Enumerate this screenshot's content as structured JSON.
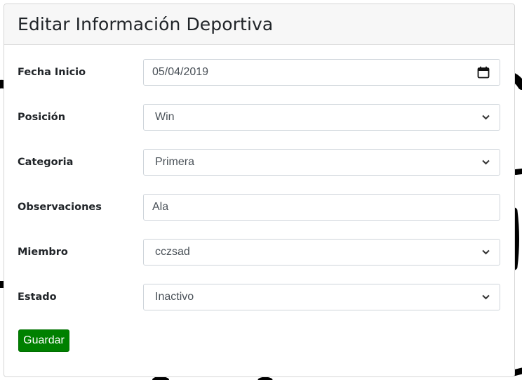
{
  "form": {
    "title": "Editar Información Deportiva",
    "fields": [
      {
        "label": "Fecha Inicio",
        "value": "05/04/2019",
        "type": "date",
        "icon": "calendar-icon"
      },
      {
        "label": "Posición",
        "value": "Win",
        "type": "select",
        "icon": "chevron-down-icon"
      },
      {
        "label": "Categoria",
        "value": "Primera",
        "type": "select",
        "icon": "chevron-down-icon"
      },
      {
        "label": "Observaciones",
        "value": "Ala",
        "type": "text"
      },
      {
        "label": "Miembro",
        "value": "cczsad",
        "type": "select",
        "icon": "chevron-down-icon"
      },
      {
        "label": "Estado",
        "value": "Inactivo",
        "type": "select",
        "icon": "chevron-down-icon"
      }
    ],
    "save_label": "Guardar"
  },
  "colors": {
    "save_button": "#008000",
    "header_background": "#f7f7f7",
    "input_border": "#ced4da"
  }
}
